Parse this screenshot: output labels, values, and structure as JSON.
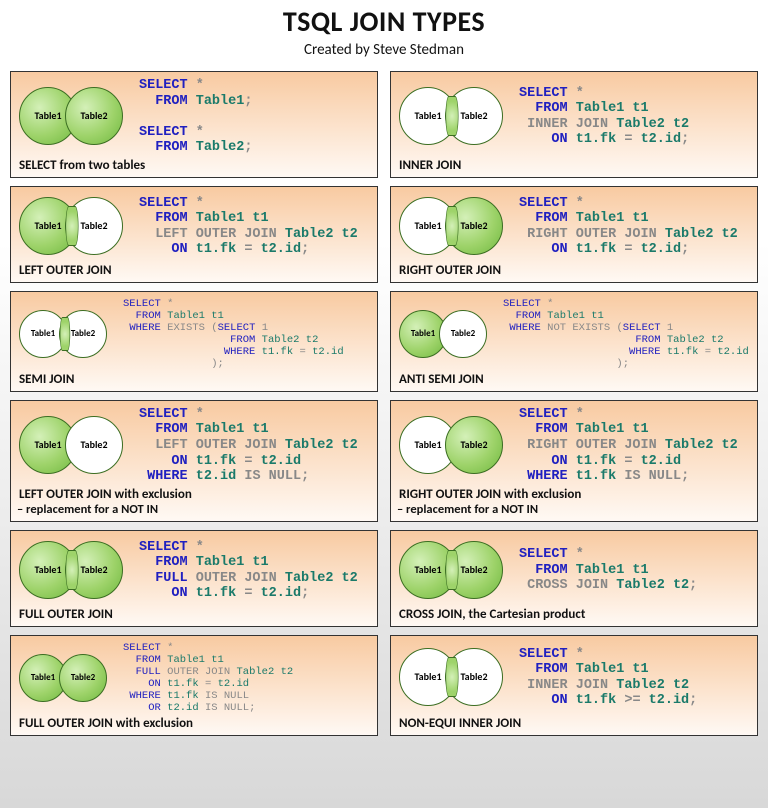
{
  "header": {
    "title": "TSQL JOIN TYPES",
    "subtitle": "Created by Steve Stedman"
  },
  "labels": {
    "t1": "Table1",
    "t2": "Table2"
  },
  "panels": {
    "p0": {
      "caption": "SELECT from two tables",
      "code": "<span class='kw'>SELECT</span> <span class='gray'>*</span>\n  <span class='kw'>FROM</span> <span class='tbl'>Table1</span><span class='gray'>;</span>\n\n<span class='kw'>SELECT</span> <span class='gray'>*</span>\n  <span class='kw'>FROM</span> <span class='tbl'>Table2</span><span class='gray'>;</span>",
      "venn": {
        "left": "green",
        "right": "green",
        "inter": false
      }
    },
    "p1": {
      "caption": "INNER JOIN",
      "code": "<span class='kw'>SELECT</span> <span class='gray'>*</span>\n  <span class='kw'>FROM</span> <span class='tbl'>Table1 t1</span>\n <span class='gray'>INNER JOIN</span> <span class='tbl'>Table2 t2</span>\n    <span class='kw'>ON</span> <span class='tbl'>t1.fk</span> <span class='gray'>=</span> <span class='tbl'>t2.id</span><span class='gray'>;</span>",
      "venn": {
        "left": "plain",
        "right": "plain",
        "inter": true
      }
    },
    "p2": {
      "caption": "LEFT OUTER JOIN",
      "code": "<span class='kw'>SELECT</span> <span class='gray'>*</span>\n  <span class='kw'>FROM</span> <span class='tbl'>Table1 t1</span>\n  <span class='gray'>LEFT OUTER JOIN</span> <span class='tbl'>Table2 t2</span>\n    <span class='kw'>ON</span> <span class='tbl'>t1.fk</span> <span class='gray'>=</span> <span class='tbl'>t2.id</span><span class='gray'>;</span>",
      "venn": {
        "left": "green",
        "right": "plain",
        "inter": true
      }
    },
    "p3": {
      "caption": "RIGHT OUTER JOIN",
      "code": "<span class='kw'>SELECT</span> <span class='gray'>*</span>\n  <span class='kw'>FROM</span> <span class='tbl'>Table1 t1</span>\n <span class='gray'>RIGHT OUTER JOIN</span> <span class='tbl'>Table2 t2</span>\n    <span class='kw'>ON</span> <span class='tbl'>t1.fk</span> <span class='gray'>=</span> <span class='tbl'>t2.id</span><span class='gray'>;</span>",
      "venn": {
        "left": "plain",
        "right": "green",
        "inter": true
      }
    },
    "p4": {
      "caption": "SEMI JOIN",
      "code": "<span class='kw'>SELECT</span> <span class='gray'>*</span>\n  <span class='kw'>FROM</span> <span class='tbl'>Table1 t1</span>\n <span class='kw'>WHERE</span> <span class='gray'>EXISTS (</span><span class='kw'>SELECT</span> <span class='gray'>1</span>\n                 <span class='kw'>FROM</span> <span class='tbl'>Table2 t2</span>\n                <span class='kw'>WHERE</span> <span class='tbl'>t1.fk</span> <span class='gray'>=</span> <span class='tbl'>t2.id</span>\n              <span class='gray'>);</span>",
      "venn": {
        "left": "plain",
        "right": "plain",
        "inter": true,
        "small": true
      }
    },
    "p5": {
      "caption": "ANTI SEMI JOIN",
      "code": "<span class='kw'>SELECT</span> <span class='gray'>*</span>\n  <span class='kw'>FROM</span> <span class='tbl'>Table1 t1</span>\n <span class='kw'>WHERE</span> <span class='gray'>NOT EXISTS (</span><span class='kw'>SELECT</span> <span class='gray'>1</span>\n                     <span class='kw'>FROM</span> <span class='tbl'>Table2 t2</span>\n                    <span class='kw'>WHERE</span> <span class='tbl'>t1.fk</span> <span class='gray'>=</span> <span class='tbl'>t2.id</span>\n                  <span class='gray'>);</span>",
      "venn": {
        "left": "green",
        "right": "plain",
        "inter": false,
        "small": true
      }
    },
    "p6": {
      "caption": "LEFT OUTER JOIN with exclusion",
      "caption2": " – replacement for a NOT IN",
      "code": "<span class='kw'>SELECT</span> <span class='gray'>*</span>\n  <span class='kw'>FROM</span> <span class='tbl'>Table1 t1</span>\n  <span class='gray'>LEFT OUTER JOIN</span> <span class='tbl'>Table2 t2</span>\n    <span class='kw'>ON</span> <span class='tbl'>t1.fk</span> <span class='gray'>=</span> <span class='tbl'>t2.id</span>\n <span class='kw'>WHERE</span> <span class='tbl'>t2.id</span> <span class='gray'>IS NULL;</span>",
      "venn": {
        "left": "green",
        "right": "plain",
        "inter": false
      }
    },
    "p7": {
      "caption": "RIGHT OUTER JOIN with exclusion",
      "caption2": " – replacement for a NOT IN",
      "code": "<span class='kw'>SELECT</span> <span class='gray'>*</span>\n  <span class='kw'>FROM</span> <span class='tbl'>Table1 t1</span>\n <span class='gray'>RIGHT OUTER JOIN</span> <span class='tbl'>Table2 t2</span>\n    <span class='kw'>ON</span> <span class='tbl'>t1.fk</span> <span class='gray'>=</span> <span class='tbl'>t2.id</span>\n <span class='kw'>WHERE</span> <span class='tbl'>t1.fk</span> <span class='gray'>IS NULL;</span>",
      "venn": {
        "left": "plain",
        "right": "green",
        "inter": false
      }
    },
    "p8": {
      "caption": "FULL OUTER JOIN",
      "code": "<span class='kw'>SELECT</span> <span class='gray'>*</span>\n  <span class='kw'>FROM</span> <span class='tbl'>Table1 t1</span>\n  <span class='kw'>FULL</span> <span class='gray'>OUTER JOIN</span> <span class='tbl'>Table2 t2</span>\n    <span class='kw'>ON</span> <span class='tbl'>t1.fk</span> <span class='gray'>=</span> <span class='tbl'>t2.id</span><span class='gray'>;</span>",
      "venn": {
        "left": "green",
        "right": "green",
        "inter": true
      }
    },
    "p9": {
      "caption": "CROSS JOIN, the Cartesian product",
      "code": "<span class='kw'>SELECT</span> <span class='gray'>*</span>\n  <span class='kw'>FROM</span> <span class='tbl'>Table1 t1</span>\n <span class='gray'>CROSS JOIN</span> <span class='tbl'>Table2 t2</span><span class='gray'>;</span>",
      "venn": {
        "left": "green",
        "right": "green",
        "inter": true
      }
    },
    "p10": {
      "caption": "FULL OUTER JOIN with exclusion",
      "code": "<span class='kw'>SELECT</span> <span class='gray'>*</span>\n  <span class='kw'>FROM</span> <span class='tbl'>Table1 t1</span>\n  <span class='kw'>FULL</span> <span class='gray'>OUTER JOIN</span> <span class='tbl'>Table2 t2</span>\n    <span class='kw'>ON</span> <span class='tbl'>t1.fk</span> <span class='gray'>=</span> <span class='tbl'>t2.id</span>\n <span class='kw'>WHERE</span> <span class='tbl'>t1.fk</span> <span class='gray'>IS NULL</span>\n    <span class='kw'>OR</span> <span class='tbl'>t2.id</span> <span class='gray'>IS NULL;</span>",
      "venn": {
        "left": "green",
        "right": "green",
        "inter": false,
        "small": true
      }
    },
    "p11": {
      "caption": "NON-EQUI INNER JOIN",
      "code": "<span class='kw'>SELECT</span> <span class='gray'>*</span>\n  <span class='kw'>FROM</span> <span class='tbl'>Table1 t1</span>\n <span class='gray'>INNER JOIN</span> <span class='tbl'>Table2 t2</span>\n    <span class='kw'>ON</span> <span class='tbl'>t1.fk</span> <span class='gray'>&gt;=</span> <span class='tbl'>t2.id</span><span class='gray'>;</span>",
      "venn": {
        "left": "plain",
        "right": "plain",
        "inter": true
      }
    }
  },
  "order": [
    "p0",
    "p1",
    "p2",
    "p3",
    "p4",
    "p5",
    "p6",
    "p7",
    "p8",
    "p9",
    "p10",
    "p11"
  ]
}
